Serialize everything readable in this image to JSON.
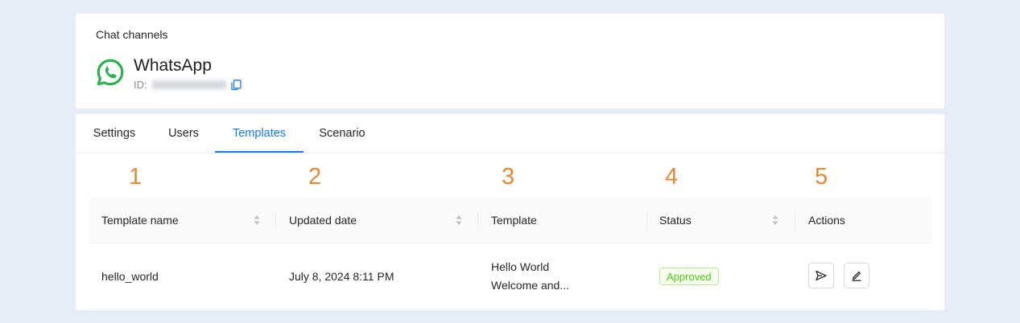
{
  "header": {
    "breadcrumb": "Chat channels",
    "app_name": "WhatsApp",
    "id_label": "ID:",
    "brand_color": "#25D366"
  },
  "tabs": [
    {
      "label": "Settings",
      "active": false
    },
    {
      "label": "Users",
      "active": false
    },
    {
      "label": "Templates",
      "active": true
    },
    {
      "label": "Scenario",
      "active": false
    }
  ],
  "annotations": [
    "1",
    "2",
    "3",
    "4",
    "5"
  ],
  "table": {
    "columns": [
      "Template name",
      "Updated date",
      "Template",
      "Status",
      "Actions"
    ],
    "rows": [
      {
        "name": "hello_world",
        "updated": "July 8, 2024 8:11 PM",
        "template_line1": "Hello World",
        "template_line2": "Welcome and...",
        "status": "Approved",
        "actions": [
          "send-icon",
          "edit-icon"
        ]
      }
    ]
  },
  "colors": {
    "accent": "#1677ff",
    "annotation": "#e48a2f",
    "status_approved": "#52c41a"
  }
}
